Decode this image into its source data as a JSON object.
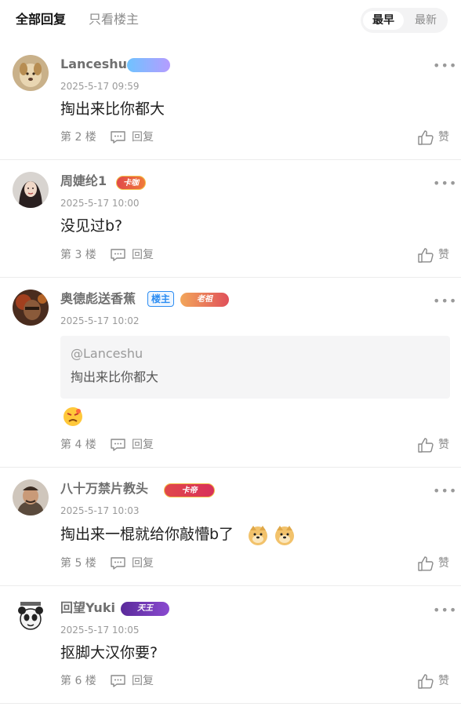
{
  "tabs": {
    "all_replies": "全部回复",
    "only_op": "只看楼主"
  },
  "sort": {
    "earliest": "最早",
    "latest": "最新"
  },
  "actions": {
    "reply": "回复",
    "like": "赞",
    "more": "•••",
    "op_badge": "楼主"
  },
  "posts": [
    {
      "username": "Lanceshu",
      "badge_text": "",
      "time": "2025-5-17 09:59",
      "content": "掏出来比你都大",
      "floor": "第 2 楼"
    },
    {
      "username": "周婕纶1",
      "badge_text": "卡咖",
      "time": "2025-5-17 10:00",
      "content": "没见过b?",
      "floor": "第 3 楼"
    },
    {
      "username": "奥德彪送香蕉",
      "badge_text": "老祖",
      "time": "2025-5-17 10:02",
      "quote_user": "@Lanceshu",
      "quote_text": "掏出来比你都大",
      "content": "",
      "floor": "第 4 楼"
    },
    {
      "username": "八十万禁片教头",
      "badge_text": "卡帝",
      "time": "2025-5-17 10:03",
      "content": "掏出来一棍就给你敲懵b了",
      "floor": "第 5 楼"
    },
    {
      "username": "回望Yuki",
      "badge_text": "天王",
      "time": "2025-5-17 10:05",
      "content": "抠脚大汉你要?",
      "floor": "第 6 楼"
    }
  ],
  "colors": {
    "op_badge": "#2b8cf2",
    "text_secondary": "#8a8a8a"
  }
}
